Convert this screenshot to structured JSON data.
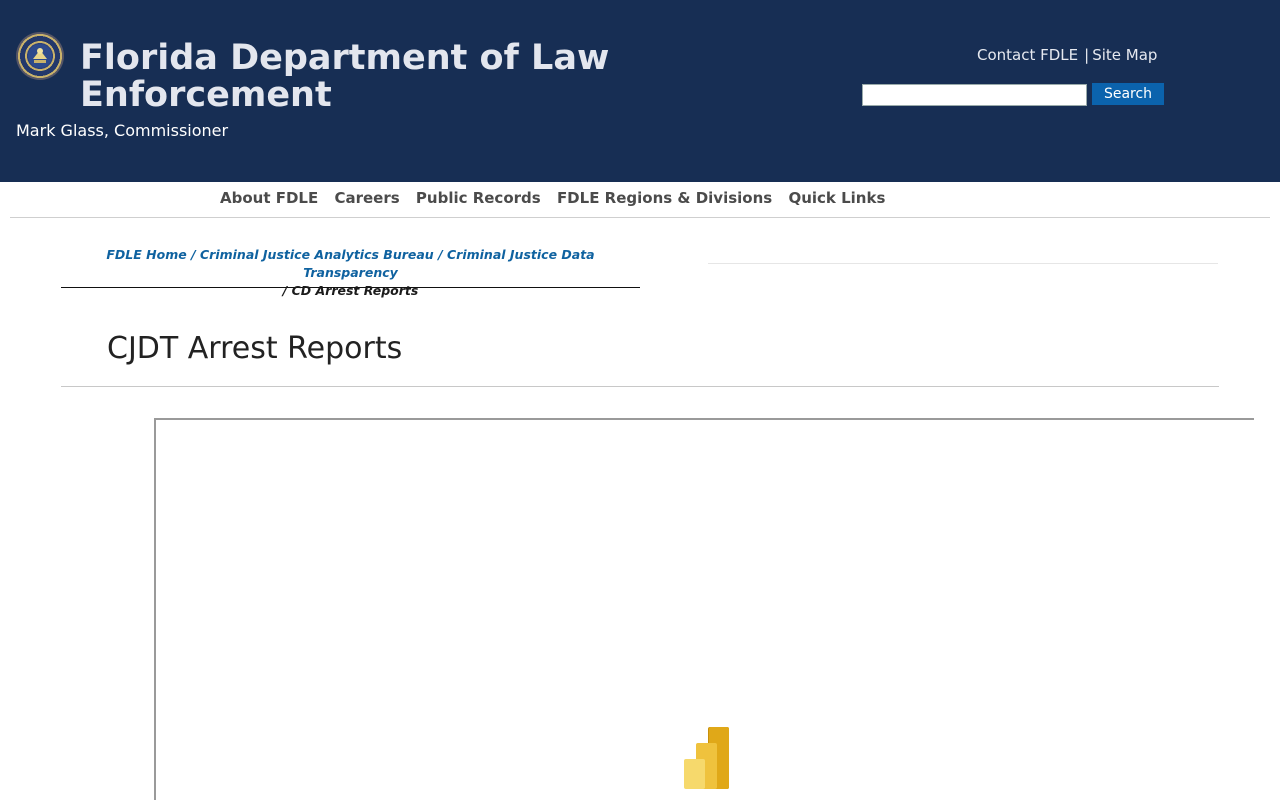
{
  "header": {
    "title": "Florida Department of Law Enforcement",
    "subtitle": "Mark Glass, Commissioner",
    "links": {
      "contact": "Contact FDLE",
      "separator": "|",
      "sitemap": "Site Map"
    },
    "search": {
      "value": "",
      "placeholder": "",
      "button_label": "Search"
    },
    "seal_icon": "fdle-seal-icon"
  },
  "nav": {
    "items": [
      {
        "label": "About FDLE"
      },
      {
        "label": "Careers"
      },
      {
        "label": "Public Records"
      },
      {
        "label": "FDLE Regions & Divisions"
      },
      {
        "label": "Quick Links"
      }
    ]
  },
  "breadcrumb": {
    "items": [
      {
        "label": "FDLE Home"
      },
      {
        "label": "Criminal Justice Analytics Bureau"
      },
      {
        "label": "Criminal Justice Data Transparency"
      }
    ],
    "separator": "/",
    "current": "CD Arrest Reports"
  },
  "main": {
    "title": "CJDT Arrest Reports",
    "report_icon": "power-bi-icon"
  },
  "colors": {
    "header_bg": "#172e54",
    "link": "#0f62a0",
    "button": "#0b63ad"
  }
}
